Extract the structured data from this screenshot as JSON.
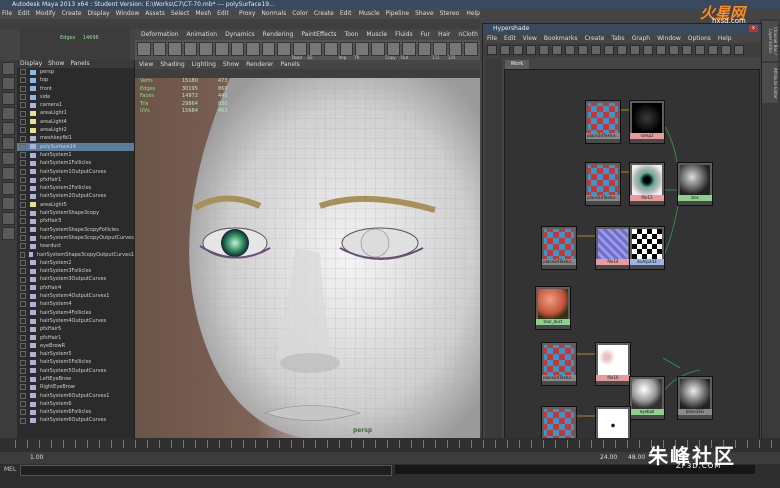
{
  "window": {
    "title": "Autodesk Maya 2013 x64 : Student Version: E:\\Works\\C7\\CT-70.mb* --- polySurface19..."
  },
  "menubar": [
    "File",
    "Edit",
    "Modify",
    "Create",
    "Display",
    "Window",
    "Assets",
    "Select",
    "Mesh",
    "Edit Mesh",
    "Proxy",
    "Normals",
    "Color",
    "Create UVs",
    "Edit UVs",
    "Muscle",
    "Pipeline Cache",
    "Shave",
    "Stereo Select",
    "Help"
  ],
  "shelf": {
    "tabs": [
      "Deformation",
      "Animation",
      "Dynamics",
      "Rendering",
      "PaintEffects",
      "Toon",
      "Muscle",
      "Fluids",
      "Fur",
      "Hair",
      "nCloth",
      "Custom",
      "GoZBrush"
    ],
    "active": "Custom",
    "buttons": [
      "Road",
      "ES",
      "Imp",
      "TR",
      "Copy",
      "Out",
      "111",
      "135"
    ]
  },
  "hud_top": {
    "rows": [
      {
        "k": "Edges",
        "v": "14696"
      }
    ]
  },
  "viewport": {
    "menu": [
      "View",
      "Shading",
      "Lighting",
      "Show",
      "Renderer",
      "Panels"
    ],
    "stats": [
      {
        "k": "Verts",
        "a": "15180",
        "b": "473"
      },
      {
        "k": "Edges",
        "a": "30195",
        "b": "860"
      },
      {
        "k": "Faces",
        "a": "14972",
        "b": "440"
      },
      {
        "k": "Tris",
        "a": "29864",
        "b": "830"
      },
      {
        "k": "UVs",
        "a": "15684",
        "b": "463"
      }
    ],
    "label": "persp"
  },
  "outliner": {
    "menu": [
      "Display",
      "Show",
      "Panels"
    ],
    "items": [
      "persp",
      "top",
      "front",
      "side",
      "camera1",
      "areaLight1",
      "areaLight4",
      "areaLight2",
      "meshkeyfbl1",
      "polySurface14",
      "hairSystem1",
      "hairSystem1Follicles",
      "hairSystem1OutputCurves",
      "pfxHair1",
      "hairSystem2Follicles",
      "hairSystem2OutputCurves",
      "areaLight5",
      "hairSystemShape3copy",
      "pfxHair3",
      "hairSystemShape3copyFollicles",
      "hairSystemShape3copyOutputCurves",
      "tearduct",
      "hairSystemShape3copyOutputCurves1",
      "hairSystem2",
      "hairSystem3Follicles",
      "hairSystem3OutputCurves",
      "pfxHair4",
      "hairSystem4OutputCurves1",
      "hairSystem4",
      "hairSystem4Follicles",
      "hairSystem4OutputCurves",
      "pfxHair5",
      "pfxHair1",
      "eyeBrowR",
      "hairSystem5",
      "hairSystem5Follicles",
      "hairSystem5OutputCurves",
      "LeftEyeBrow",
      "RightEyeBrow",
      "hairSystem6OutputCurves1",
      "hairSystem6",
      "hairSystem6Follicles",
      "hairSystem6OutputCurves"
    ],
    "selected_index": 9
  },
  "hypershade": {
    "title": "Hypershade",
    "menu": [
      "File",
      "Edit",
      "View",
      "Bookmarks",
      "Create",
      "Tabs",
      "Graph",
      "Window",
      "Options",
      "Help"
    ],
    "tab": "Work Area",
    "close": "x",
    "nodes": [
      {
        "label": "place2dTextur...",
        "kind": "gray",
        "swatch": "place"
      },
      {
        "label": "ramp2",
        "kind": "red",
        "swatch": "ramp"
      },
      {
        "label": "place2dTextur...",
        "kind": "gray",
        "swatch": "place"
      },
      {
        "label": "file13",
        "kind": "red",
        "swatch": "eye"
      },
      {
        "label": "bns",
        "kind": "green",
        "swatch": "env"
      },
      {
        "label": "place2dTextur...",
        "kind": "gray",
        "swatch": "place"
      },
      {
        "label": "file14",
        "kind": "red",
        "swatch": "noise"
      },
      {
        "label": "bump2d3",
        "kind": "blue",
        "swatch": "checker"
      },
      {
        "label": "tear_duct",
        "kind": "green",
        "swatch": "sphere"
      },
      {
        "label": "place2dTextur...",
        "kind": "gray",
        "swatch": "place"
      },
      {
        "label": "file16",
        "kind": "red",
        "swatch": "spots"
      },
      {
        "label": "eyeball",
        "kind": "green",
        "swatch": "ball"
      },
      {
        "label": "blinn3SG",
        "kind": "gray",
        "swatch": "sg"
      },
      {
        "label": "place2dTextur...",
        "kind": "gray",
        "swatch": "place"
      },
      {
        "label": "file17",
        "kind": "red",
        "swatch": "white"
      }
    ]
  },
  "right_tabs": [
    "Channel Box / Layer Editor",
    "Attribute Editor"
  ],
  "timeline": {
    "start": "1.00",
    "end": "24.00",
    "range_end": "48.00"
  },
  "cmdline": {
    "label": "MEL"
  },
  "watermark": {
    "main": "朱峰社区",
    "sub": "ZF3D.COM",
    "logo": "火星网",
    "logo_sub": "hxsd.com"
  },
  "colors": {
    "selection": "#5b7d9c",
    "hud": "#8fe08f",
    "node_green": "#8ed08e",
    "node_red": "#e79b9b"
  }
}
